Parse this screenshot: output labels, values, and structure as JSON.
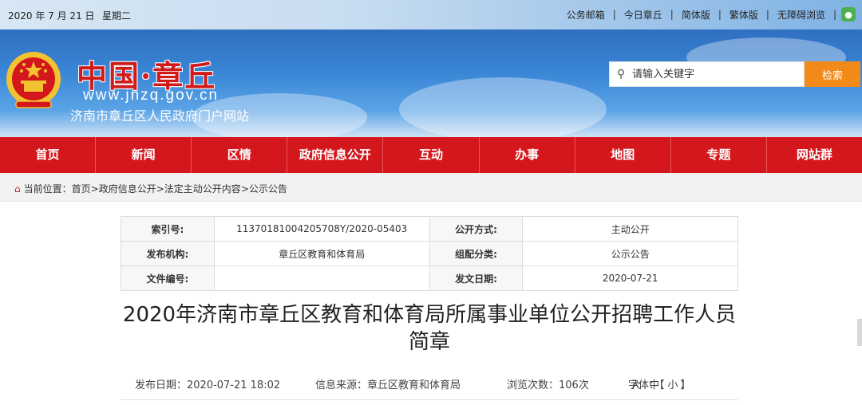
{
  "topbar": {
    "date": "2020 年 7 月 21 日",
    "weekday": "星期二",
    "links": [
      "公务邮箱",
      "今日章丘",
      "简体版",
      "繁体版",
      "无障碍浏览"
    ],
    "wechat_icon": "wechat-icon"
  },
  "header": {
    "site_name": "中国·章丘",
    "site_url": "www.jnzq.gov.cn",
    "site_desc": "济南市章丘区人民政府门户网站",
    "search": {
      "placeholder": "请输入关键字",
      "button": "检索"
    },
    "colors": {
      "accent_red": "#d4171c",
      "search_orange": "#f28a1a",
      "header_blue": "#3a86d6"
    }
  },
  "nav": [
    "首页",
    "新闻",
    "区情",
    "政府信息公开",
    "互动",
    "办事",
    "地图",
    "专题",
    "网站群"
  ],
  "breadcrumb": {
    "prefix": "当前位置：",
    "items": [
      "首页",
      "政府信息公开",
      "法定主动公开内容",
      "公示公告"
    ],
    "separator": ">"
  },
  "meta": {
    "index_label": "索引号:",
    "index_value": "11370181004205708Y/2020-05403",
    "open_label": "公开方式:",
    "open_value": "主动公开",
    "org_label": "发布机构:",
    "org_value": "章丘区教育和体育局",
    "category_label": "组配分类:",
    "category_value": "公示公告",
    "doc_label": "文件编号:",
    "doc_value": "",
    "date_label": "发文日期:",
    "date_value": "2020-07-21"
  },
  "article": {
    "title": "2020年济南市章丘区教育和体育局所属事业单位公开招聘工作人员简章",
    "publish": "发布日期：2020-07-21 18:02",
    "source": "信息来源：章丘区教育和体育局",
    "views": "浏览次数：106次",
    "font_label": "字体：【",
    "font_large": "大",
    "font_medium": "中",
    "font_small": "小",
    "font_end": "】"
  }
}
